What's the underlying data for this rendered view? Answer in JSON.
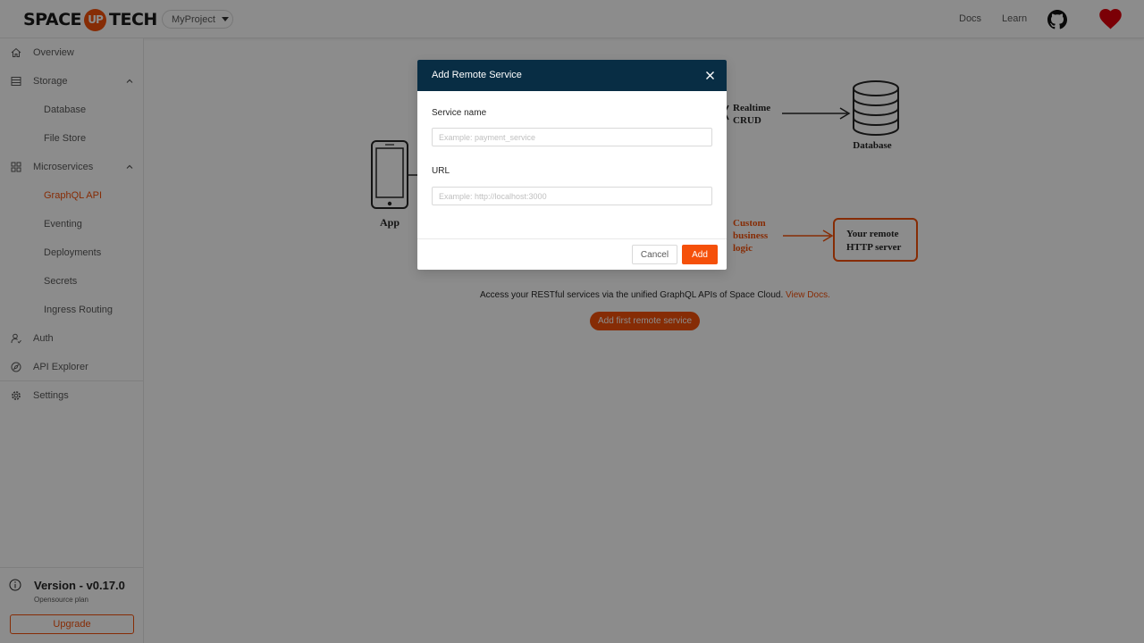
{
  "header": {
    "logo_left": "SPACE",
    "logo_mid": "UP",
    "logo_right": "TECH",
    "project": "MyProject",
    "links": [
      "Docs",
      "Learn"
    ],
    "icons": [
      "github-icon",
      "heart-icon"
    ]
  },
  "sidebar": {
    "items": [
      {
        "label": "Overview",
        "icon": "home-icon"
      },
      {
        "label": "Storage",
        "icon": "storage-icon"
      },
      {
        "label": "Database"
      },
      {
        "label": "File Store"
      },
      {
        "label": "Microservices",
        "icon": "microservices-icon"
      },
      {
        "label": "GraphQL API",
        "active": true
      },
      {
        "label": "Eventing"
      },
      {
        "label": "Deployments"
      },
      {
        "label": "Secrets"
      },
      {
        "label": "Ingress Routing"
      },
      {
        "label": "Auth",
        "icon": "auth-icon"
      },
      {
        "label": "API Explorer",
        "icon": "compass-icon"
      },
      {
        "label": "Settings",
        "icon": "gear-icon"
      }
    ],
    "version": "Version - v0.17.0",
    "plan": "Opensource plan",
    "upgrade": "Upgrade"
  },
  "main": {
    "diagram": {
      "app": "App",
      "realtime_line1": "Realtime",
      "realtime_line2": "CRUD",
      "database": "Database",
      "custom_line1": "Custom",
      "custom_line2": "business",
      "custom_line3": "logic",
      "remote_line1": "Your remote",
      "remote_line2": "HTTP server"
    },
    "description": "Access your RESTful services via the unified GraphQL APIs of Space Cloud.",
    "view_docs": "View Docs.",
    "cta": "Add first remote service"
  },
  "modal": {
    "title": "Add Remote Service",
    "service_label": "Service name",
    "service_placeholder": "Example: payment_service",
    "service_value": "",
    "url_label": "URL",
    "url_placeholder": "Example: http://localhost:3000",
    "url_value": "",
    "cancel": "Cancel",
    "add": "Add"
  },
  "colors": {
    "accent": "#f5500a",
    "modal_header": "#082d44",
    "overlay": "rgba(0,0,0,0.45)"
  }
}
